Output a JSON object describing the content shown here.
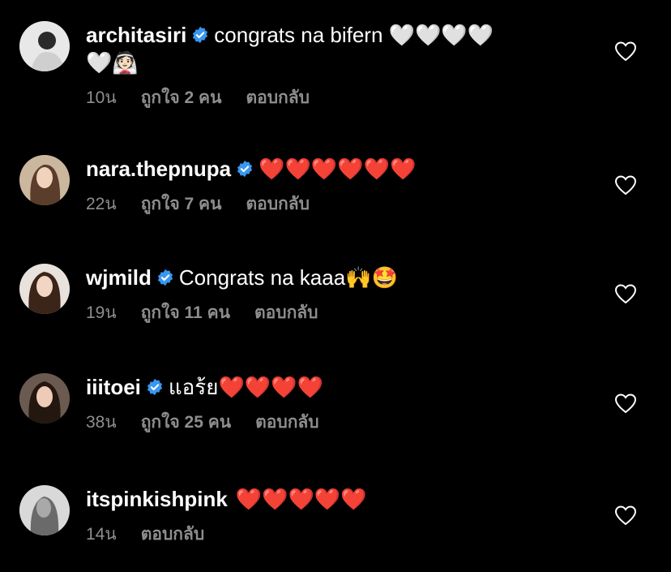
{
  "comments": [
    {
      "username": "architasiri",
      "text": "congrats na bifern 🤍🤍🤍🤍",
      "text2": "🤍👰🏻",
      "time": "10น",
      "likes": "ถูกใจ 2 คน",
      "reply": "ตอบกลับ"
    },
    {
      "username": "nara.thepnupa",
      "text": "❤️❤️❤️❤️❤️❤️",
      "time": "22น",
      "likes": "ถูกใจ 7 คน",
      "reply": "ตอบกลับ"
    },
    {
      "username": "wjmild",
      "text": "Congrats na kaaa🙌🤩",
      "time": "19น",
      "likes": "ถูกใจ 11 คน",
      "reply": "ตอบกลับ"
    },
    {
      "username": "iiitoei",
      "text": "แอร้ย❤️❤️❤️❤️",
      "time": "38น",
      "likes": "ถูกใจ 25 คน",
      "reply": "ตอบกลับ"
    },
    {
      "username": "itspinkishpink",
      "text": "❤️❤️❤️❤️❤️",
      "time": "14น",
      "reply": "ตอบกลับ"
    }
  ],
  "colors": {
    "background": "#000000",
    "secondary_text": "#8e8e8e",
    "verified_badge": "#3897f0"
  },
  "icons": {
    "verified": "verified-badge-icon",
    "like": "heart-outline-icon"
  }
}
